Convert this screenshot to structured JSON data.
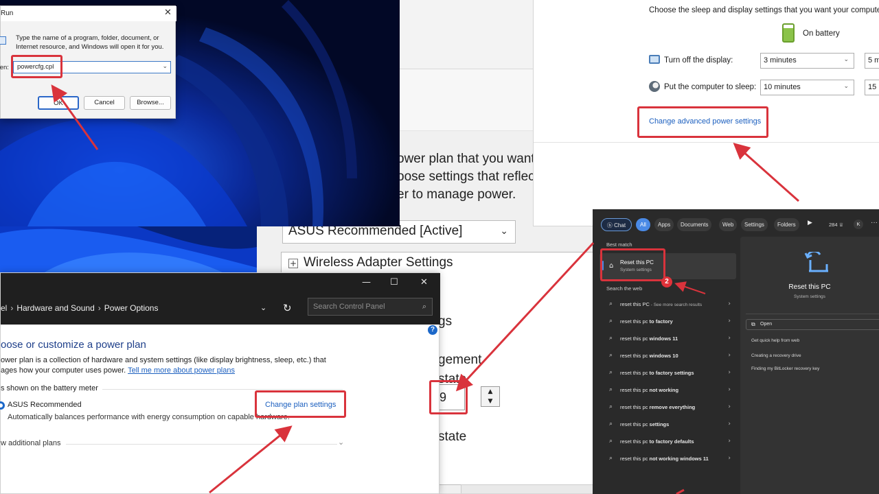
{
  "run_dialog": {
    "title": "Run",
    "description": "Type the name of a program, folder, document, or Internet resource, and Windows will open it for you.",
    "open_label": "Open:",
    "input_value": "powercfg.cpl",
    "ok": "OK",
    "cancel": "Cancel",
    "browse": "Browse..."
  },
  "advanced_settings": {
    "intro_lines": [
      "ower plan that you want",
      "oose settings that reflect",
      "er to manage power."
    ],
    "plan_select": "ASUS Recommended [Active]",
    "tree_item": "Wireless Adapter Settings",
    "fragment_1": "gs",
    "fragment_2": "gement",
    "fragment_3": "state",
    "spin_value": "9",
    "fragment_4": "state"
  },
  "control_panel": {
    "window_controls": [
      "—",
      "☐",
      "✕"
    ],
    "breadcrumb": [
      "el",
      "Hardware and Sound",
      "Power Options"
    ],
    "search_placeholder": "Search Control Panel",
    "heading": "oose or customize a power plan",
    "description_line1": "ower plan is a collection of hardware and system settings (like display brightness, sleep, etc.) that",
    "description_line2": "ages how your computer uses power.",
    "learn_more": "Tell me more about power plans",
    "meter_label": "s shown on the battery meter",
    "plan_name": "ASUS Recommended",
    "plan_description": "Automatically balances performance with energy consumption on capable hardware.",
    "change_plan": "Change plan settings",
    "more_plans": "w additional plans"
  },
  "edit_plan": {
    "intro": "Choose the sleep and display settings that you want your computer to",
    "battery_label": "On battery",
    "display_label": "Turn off the display:",
    "display_value": "3 minutes",
    "display_value_2": "5 m",
    "sleep_label": "Put the computer to sleep:",
    "sleep_value": "10 minutes",
    "sleep_value_2": "15 m",
    "advanced_link": "Change advanced power settings"
  },
  "search_panel": {
    "tabs": [
      "Chat",
      "All",
      "Apps",
      "Documents",
      "Web",
      "Settings",
      "Folders"
    ],
    "count": "284",
    "avatar": "K",
    "best_match_label": "Best match",
    "best_match_title": "Reset this PC",
    "best_match_sub": "System settings",
    "search_web_label": "Search the web",
    "web_results": [
      {
        "plain": "reset this PC",
        "bold": "",
        "sub": " - See more search results"
      },
      {
        "plain": "reset this pc ",
        "bold": "to factory",
        "sub": ""
      },
      {
        "plain": "reset this pc ",
        "bold": "windows 11",
        "sub": ""
      },
      {
        "plain": "reset this pc ",
        "bold": "windows 10",
        "sub": ""
      },
      {
        "plain": "reset this pc ",
        "bold": "to factory settings",
        "sub": ""
      },
      {
        "plain": "reset this pc ",
        "bold": "not working",
        "sub": ""
      },
      {
        "plain": "reset this pc ",
        "bold": "remove everything",
        "sub": ""
      },
      {
        "plain": "reset this pc ",
        "bold": "settings",
        "sub": ""
      },
      {
        "plain": "reset this pc ",
        "bold": "to factory defaults",
        "sub": ""
      },
      {
        "plain": "reset this pc ",
        "bold": "not working windows 11",
        "sub": ""
      }
    ],
    "right_title": "Reset this PC",
    "right_sub": "System settings",
    "open_label": "Open",
    "help_links": [
      "Get quick help from web",
      "Creating a recovery drive",
      "Finding my BitLocker recovery key"
    ],
    "step_badge": "2"
  },
  "colors": {
    "highlight": "#d9333c",
    "link": "#1b5fbf",
    "accent": "#4a8ae6"
  }
}
